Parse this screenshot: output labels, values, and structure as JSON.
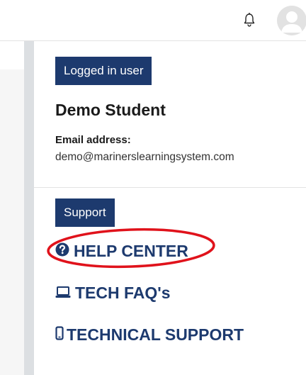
{
  "header": {
    "notifications_icon": "bell-icon",
    "avatar_icon": "user-avatar-icon"
  },
  "user_block": {
    "badge_label": "Logged in user",
    "name": "Demo Student",
    "email_label": "Email address:",
    "email": "demo@marinerslearningsystem.com"
  },
  "support_block": {
    "badge_label": "Support",
    "links": [
      {
        "label": "HELP CENTER",
        "icon": "question-circle-icon"
      },
      {
        "label": "TECH FAQ's",
        "icon": "laptop-icon"
      },
      {
        "label": "TECHNICAL SUPPORT",
        "icon": "mobile-phone-icon"
      }
    ]
  },
  "colors": {
    "brand_navy": "#1d3a6e",
    "highlight_red": "#e0121b"
  }
}
